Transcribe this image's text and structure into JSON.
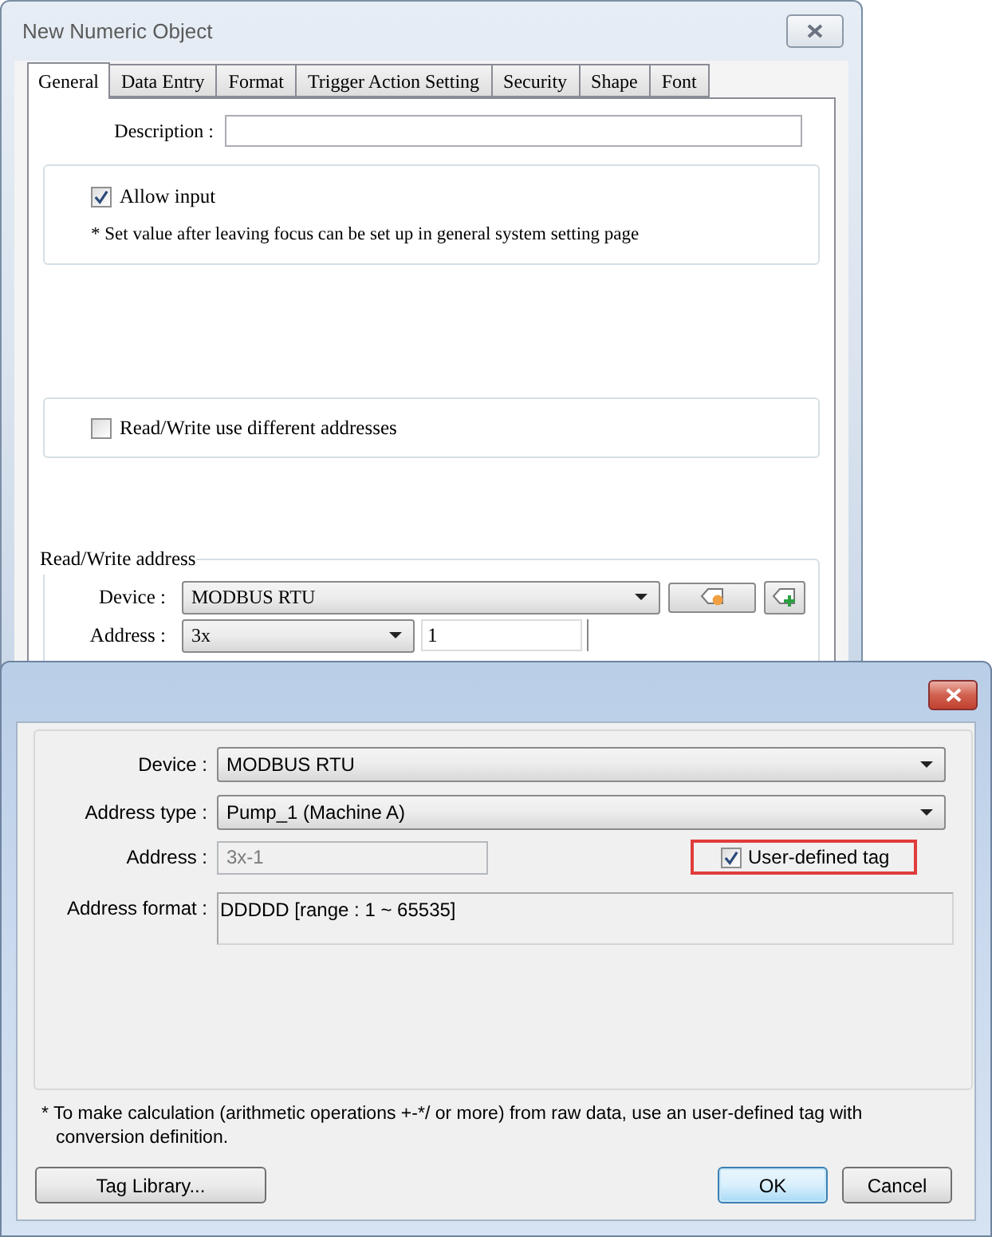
{
  "main_dialog": {
    "title": "New Numeric Object",
    "tabs": [
      {
        "label": "General",
        "selected": true
      },
      {
        "label": "Data Entry",
        "selected": false
      },
      {
        "label": "Format",
        "selected": false
      },
      {
        "label": "Trigger Action Setting",
        "selected": false
      },
      {
        "label": "Security",
        "selected": false
      },
      {
        "label": "Shape",
        "selected": false
      },
      {
        "label": "Font",
        "selected": false
      }
    ],
    "description": {
      "label": "Description :"
    },
    "allow_input": {
      "label": "Allow input",
      "checked": true
    },
    "note": "* Set value after leaving focus can be set up in general system setting page",
    "different_addresses": {
      "label": "Read/Write use different addresses",
      "checked": false
    },
    "address_group": {
      "legend": "Read/Write address",
      "device": {
        "label": "Device :",
        "value": "MODBUS RTU"
      },
      "address": {
        "label": "Address :",
        "type_value": "3x",
        "value": "1"
      }
    }
  },
  "tag_dialog": {
    "device": {
      "label": "Device :",
      "value": "MODBUS RTU"
    },
    "address_type": {
      "label": "Address type :",
      "value": "Pump_1 (Machine A)"
    },
    "address": {
      "label": "Address :",
      "value": "3x-1",
      "disabled": true
    },
    "user_defined_tag": {
      "label": "User-defined tag",
      "checked": true,
      "highlighted": true
    },
    "address_format": {
      "label": "Address format :",
      "value": "DDDDD [range : 1 ~ 65535]"
    },
    "note": "* To make calculation (arithmetic operations +-*/ or more) from raw data, use an user-defined tag with conversion definition.",
    "buttons": [
      {
        "label": "Tag Library...",
        "focused": false
      },
      {
        "label": "OK",
        "focused": true
      },
      {
        "label": "Cancel",
        "focused": false
      }
    ]
  }
}
